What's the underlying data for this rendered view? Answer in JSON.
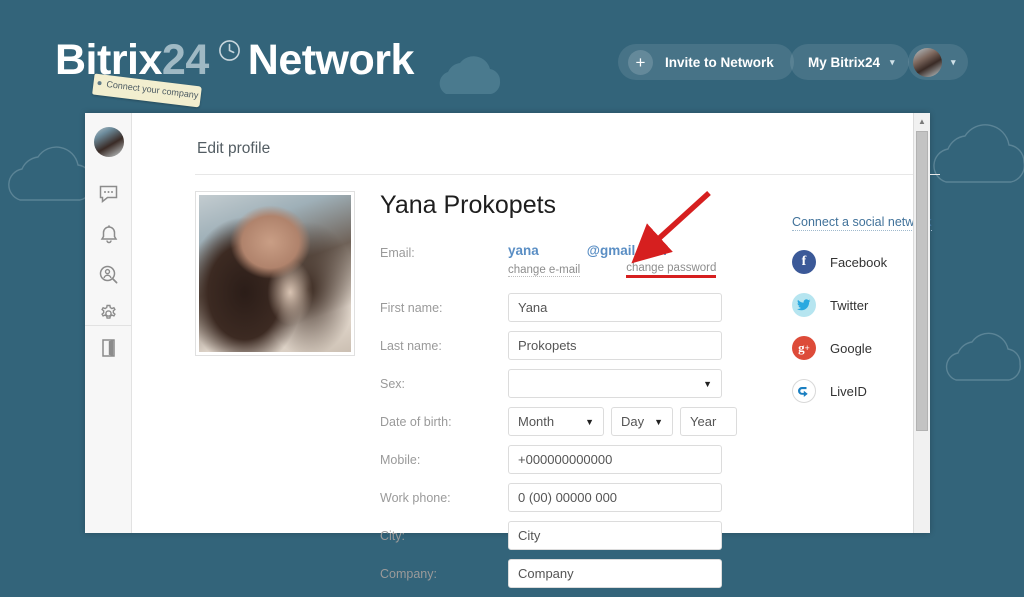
{
  "brand": {
    "name_primary": "Bitrix",
    "name_accent": "24",
    "name_secondary": "Network",
    "clock_icon": "clock-icon",
    "tag_text": "Connect your company",
    "background_color": "#33647a"
  },
  "header": {
    "invite_button": "Invite to Network",
    "invite_plus": "+",
    "my_bitrix_button": "My Bitrix24",
    "caret": "▾",
    "avatar_caret": "▾",
    "avatar_icon": "user-avatar"
  },
  "sidebar": {
    "items": [
      {
        "name": "avatar",
        "icon": "user-avatar-icon",
        "label": ""
      },
      {
        "name": "messages",
        "icon": "chat-bubble-icon",
        "label": ""
      },
      {
        "name": "notifications",
        "icon": "bell-icon",
        "label": ""
      },
      {
        "name": "search-people",
        "icon": "person-search-icon",
        "label": ""
      },
      {
        "name": "settings",
        "icon": "gear-icon",
        "label": ""
      },
      {
        "name": "logout",
        "icon": "exit-door-icon",
        "label": ""
      }
    ]
  },
  "page": {
    "title": "Edit profile"
  },
  "profile": {
    "full_name": "Yana Prokopets",
    "photo_alt": "profile-photo"
  },
  "form": {
    "email": {
      "label": "Email:",
      "value_prefix": "yana",
      "value_suffix": "@gmail.com",
      "masked": true,
      "change_email_link": "change e-mail",
      "change_password_link": "change password"
    },
    "fields": [
      {
        "label": "First name:",
        "type": "text",
        "value": "Yana"
      },
      {
        "label": "Last name:",
        "type": "text",
        "value": "Prokopets"
      },
      {
        "label": "Sex:",
        "type": "select",
        "value": ""
      },
      {
        "label": "Mobile:",
        "type": "text",
        "value": "+000000000000"
      },
      {
        "label": "Work phone:",
        "type": "text",
        "value": "0 (00) 00000 000"
      },
      {
        "label": "City:",
        "type": "text",
        "value": "City"
      },
      {
        "label": "Company:",
        "type": "text",
        "value": "Company"
      }
    ],
    "date_of_birth": {
      "label": "Date of birth:",
      "month": "Month",
      "day": "Day",
      "year": "Year",
      "arrow": "▼"
    }
  },
  "social": {
    "title": "Connect a social network",
    "networks": [
      {
        "label": "Facebook",
        "glyph": "f",
        "color": "#3b5998",
        "icon": "facebook-icon"
      },
      {
        "label": "Twitter",
        "glyph": "t",
        "color": "#b6e5f0",
        "icon": "twitter-icon"
      },
      {
        "label": "Google",
        "glyph": "g+",
        "color": "#dd4b39",
        "icon": "google-plus-icon"
      },
      {
        "label": "LiveID",
        "glyph": "e",
        "color": "#ffffff",
        "icon": "liveid-icon"
      }
    ]
  },
  "annotation": {
    "arrow_color": "#d61f1f",
    "underline_color": "#d61f1f",
    "target": "change password"
  },
  "scrollbar": {
    "up_arrow": "▲"
  }
}
